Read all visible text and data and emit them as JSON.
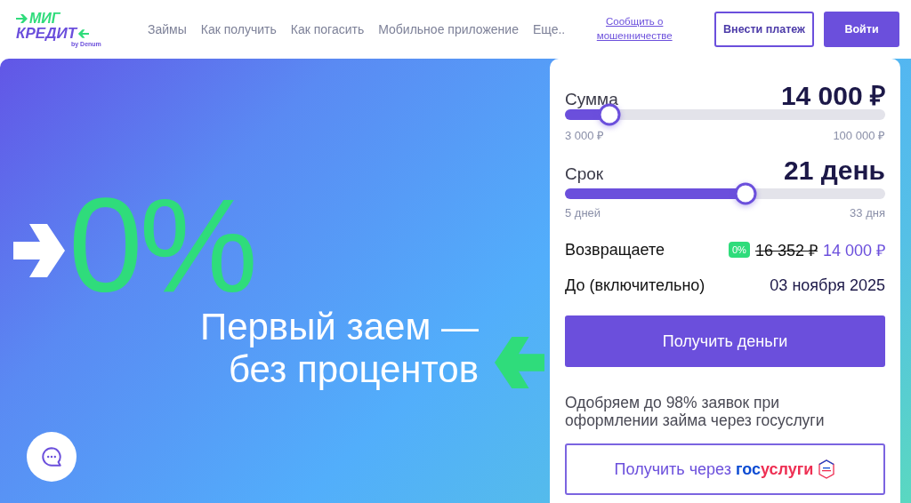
{
  "header": {
    "logo": {
      "line1": "МИГ",
      "line2": "КРЕДИТ",
      "sub": "by Denum"
    },
    "nav": [
      "Займы",
      "Как получить",
      "Как погасить",
      "Мобильное приложение",
      "Еще.."
    ],
    "report_link": "Сообщить о мошенничестве",
    "buttons": [
      {
        "label": "Внести платеж",
        "kind": "outline"
      },
      {
        "label": "Войти",
        "kind": "filled"
      }
    ]
  },
  "hero": {
    "headline": "0%",
    "subtitle_lines": [
      "Первый заем —",
      "без процентов"
    ]
  },
  "calculator": {
    "sliders": [
      {
        "label": "Сумма",
        "value": "14 000 ₽",
        "level": 0.14,
        "min": "3 000 ₽",
        "max": "100 000 ₽"
      },
      {
        "label": "Срок",
        "value": "21 день",
        "level": 0.565,
        "min": "5 дней",
        "max": "33 дня"
      }
    ],
    "repay": {
      "label": "Возвращаете",
      "badge": "0%",
      "old_amount": "16 352 ₽",
      "amount": "14 000 ₽"
    },
    "due": {
      "label": "До (включительно)",
      "date": "03 ноября 2025"
    },
    "submit": "Получить деньги",
    "note": "Одобряем до 98% заявок при оформлении займа через госуслуги",
    "gos_button": {
      "prefix": "Получить через",
      "brand": [
        {
          "text": "гос",
          "color": "#0d4cd3"
        },
        {
          "text": "услуги",
          "color": "#ee2f53"
        }
      ]
    }
  }
}
